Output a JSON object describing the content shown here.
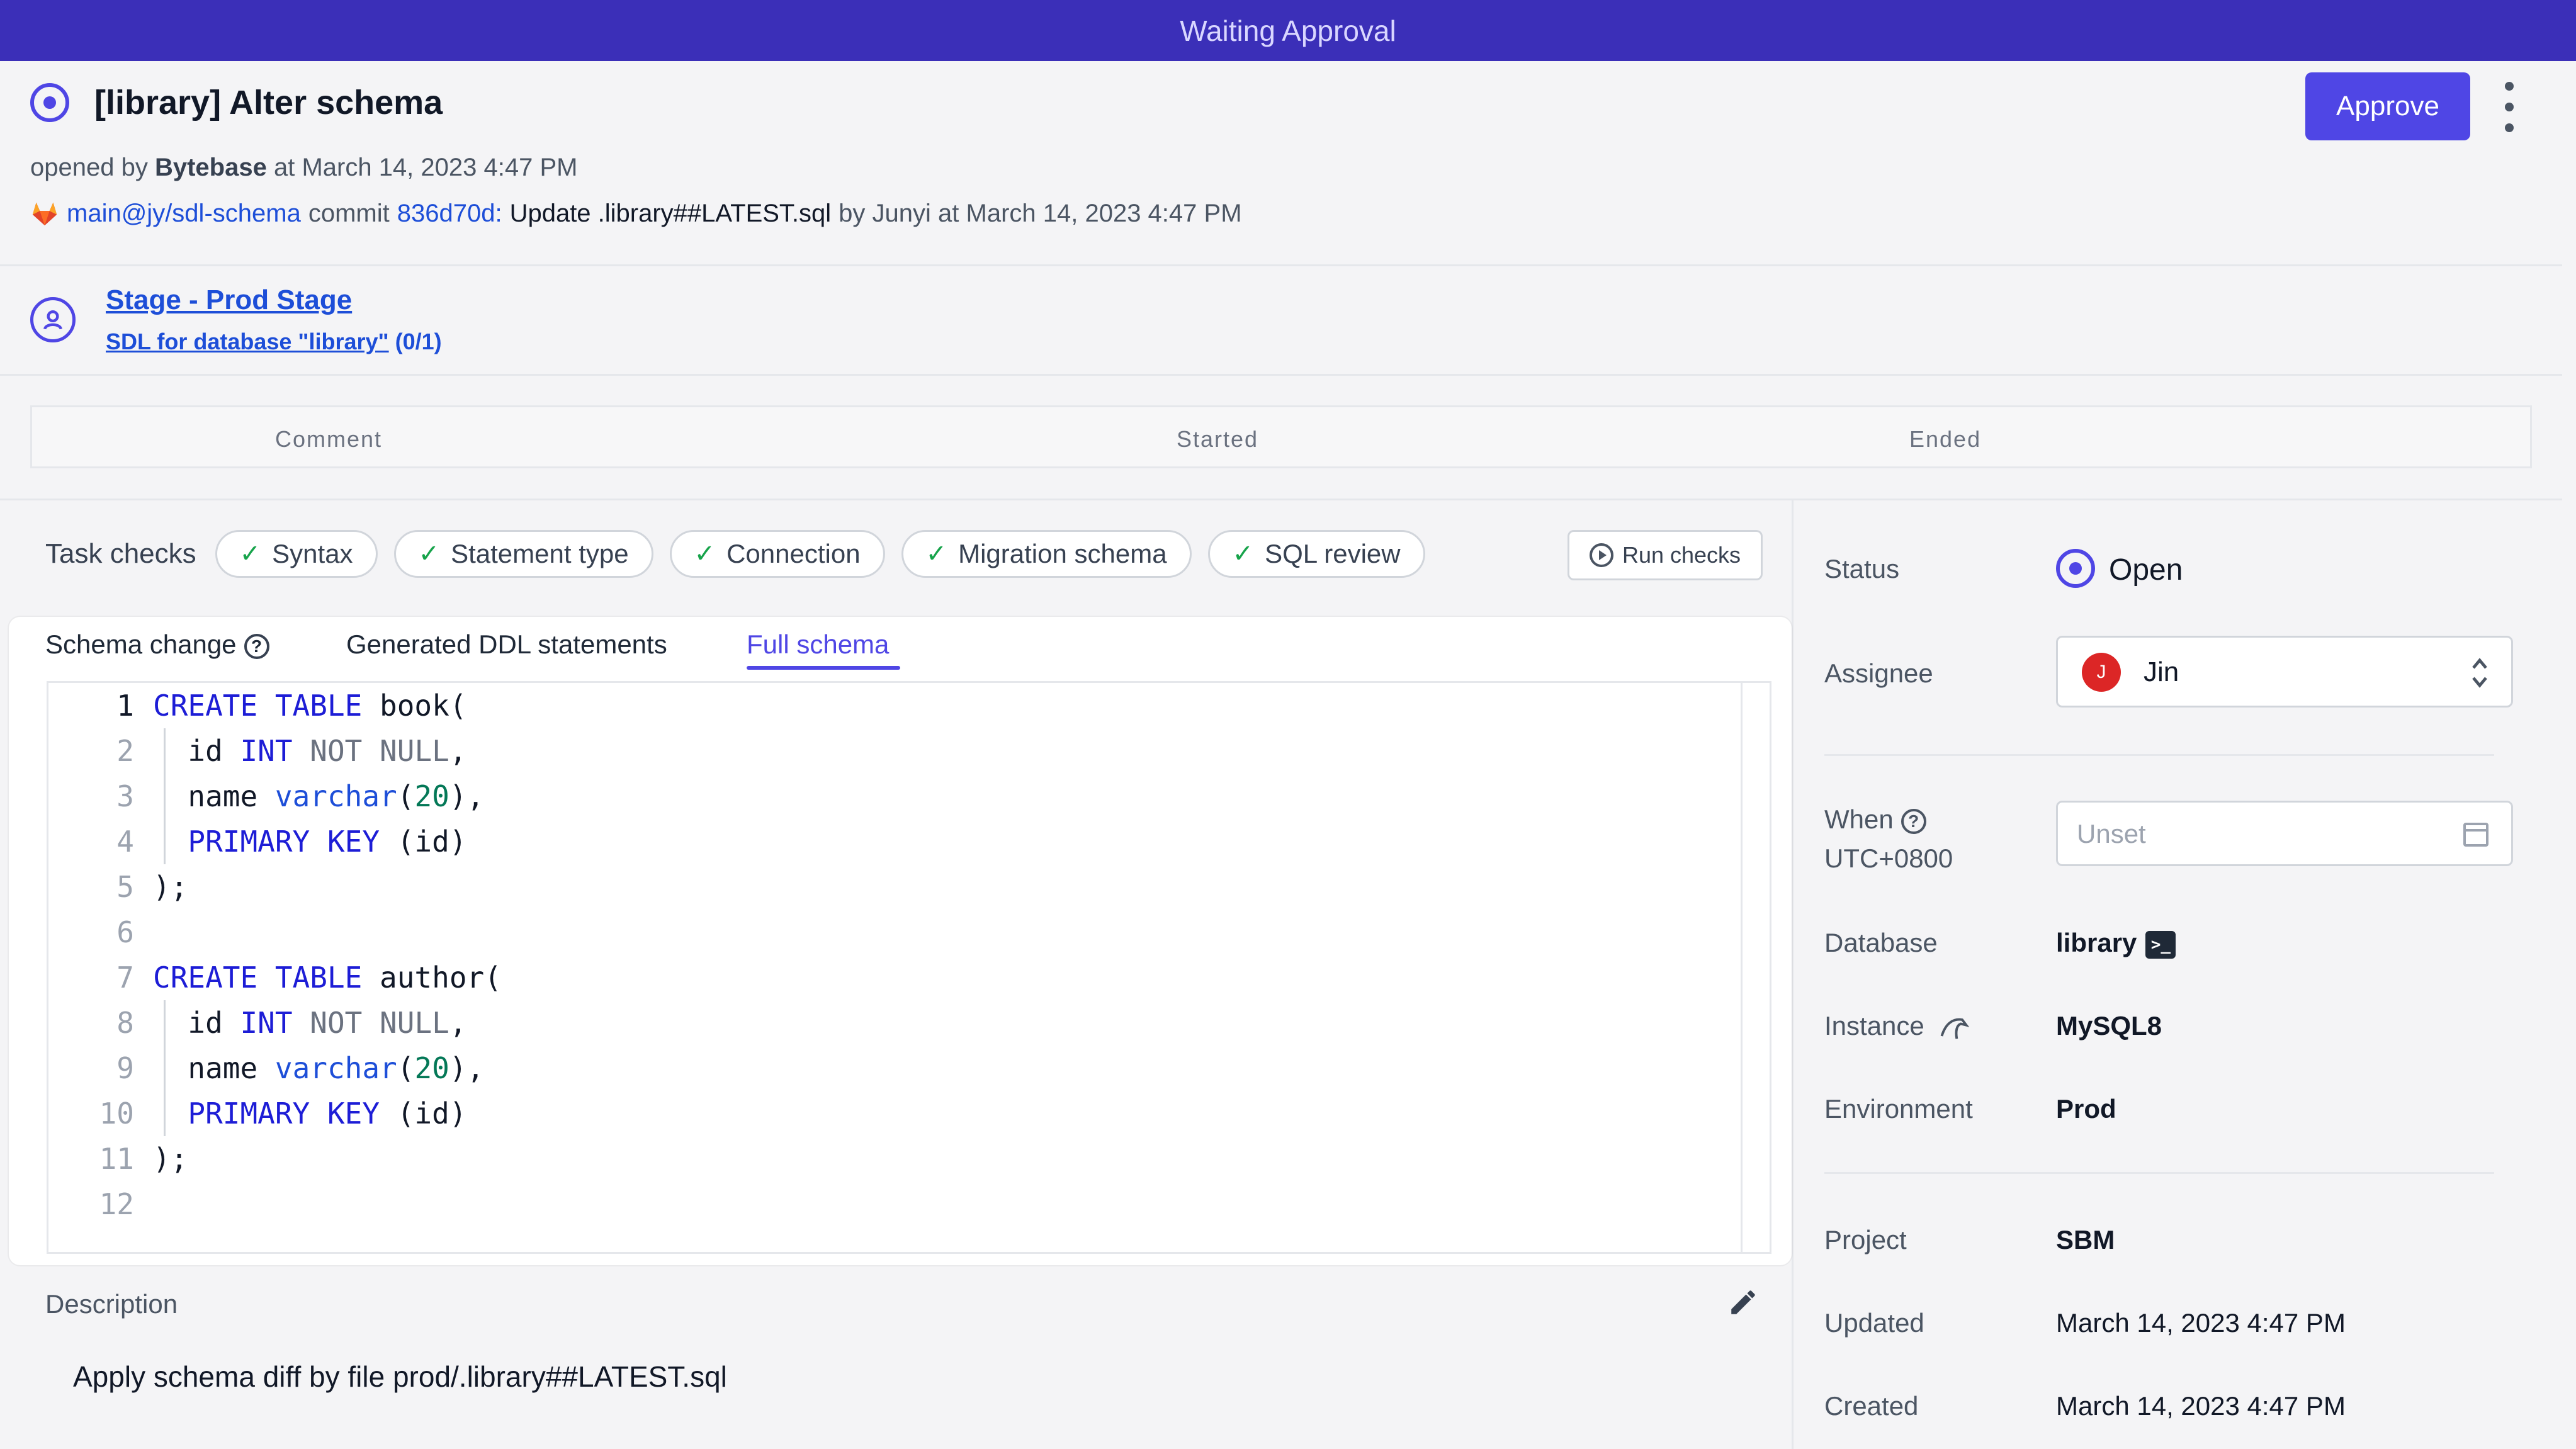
{
  "banner": {
    "text": "Waiting Approval"
  },
  "issue": {
    "title": "[library] Alter schema",
    "opened_prefix": "opened by",
    "opened_by": "Bytebase",
    "opened_at": "at March 14, 2023 4:47 PM",
    "approve_label": "Approve",
    "commit": {
      "branch": "main@jy/sdl-schema",
      "commit_word": "commit",
      "hash": "836d70d:",
      "message": "Update .library##LATEST.sql",
      "author_text": "by Junyi at March 14, 2023 4:47 PM"
    }
  },
  "stage": {
    "title": "Stage - Prod Stage",
    "task_link": "SDL for database \"library\"",
    "task_count": "(0/1)"
  },
  "timeline": {
    "columns": [
      "Comment",
      "Started",
      "Ended"
    ]
  },
  "checks": {
    "label": "Task checks",
    "items": [
      "Syntax",
      "Statement type",
      "Connection",
      "Migration schema",
      "SQL review"
    ],
    "run_label": "Run checks"
  },
  "tabs": {
    "schema_change": "Schema change",
    "generated_ddl": "Generated DDL statements",
    "full_schema": "Full schema",
    "active": "full_schema"
  },
  "code": {
    "line_numbers": [
      "1",
      "2",
      "3",
      "4",
      "5",
      "6",
      "7",
      "8",
      "9",
      "10",
      "11",
      "12"
    ],
    "lines": [
      "CREATE TABLE book(",
      "    id INT NOT NULL,",
      "    name varchar(20),",
      "    PRIMARY KEY (id)",
      ");",
      "",
      "CREATE TABLE author(",
      "    id INT NOT NULL,",
      "    name varchar(20),",
      "    PRIMARY KEY (id)",
      ");",
      ""
    ]
  },
  "description": {
    "label": "Description",
    "text": "Apply schema diff by file prod/.library##LATEST.sql"
  },
  "sidebar": {
    "status_label": "Status",
    "status_value": "Open",
    "assignee_label": "Assignee",
    "assignee_initial": "J",
    "assignee_name": "Jin",
    "when_label": "When",
    "when_tz": "UTC+0800",
    "when_placeholder": "Unset",
    "database_label": "Database",
    "database_value": "library",
    "instance_label": "Instance",
    "instance_value": "MySQL8",
    "environment_label": "Environment",
    "environment_value": "Prod",
    "project_label": "Project",
    "project_value": "SBM",
    "updated_label": "Updated",
    "updated_value": "March 14, 2023 4:47 PM",
    "created_label": "Created",
    "created_value": "March 14, 2023 4:47 PM"
  },
  "colors": {
    "accent": "#4f46e5",
    "banner": "#3b2fb8",
    "check": "#16a34a",
    "avatar": "#dc2626"
  }
}
